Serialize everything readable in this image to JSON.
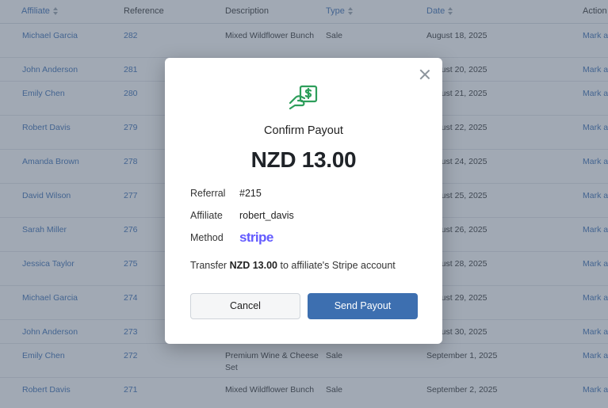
{
  "table": {
    "headers": [
      {
        "label": "Affiliate",
        "sortable": true
      },
      {
        "label": "Reference",
        "sortable": false
      },
      {
        "label": "Description",
        "sortable": false
      },
      {
        "label": "Type",
        "sortable": true
      },
      {
        "label": "Date",
        "sortable": true
      },
      {
        "label": "Action",
        "sortable": false
      }
    ],
    "rows": [
      {
        "affiliate": "Michael Garcia",
        "reference": "282",
        "description": "Mixed Wildflower Bunch",
        "type": "Sale",
        "date": "August 18, 2025",
        "action": "Mark as"
      },
      {
        "affiliate": "John Anderson",
        "reference": "281",
        "description": "",
        "type": "",
        "date": "August 20, 2025",
        "action": "Mark as"
      },
      {
        "affiliate": "Emily Chen",
        "reference": "280",
        "description": "",
        "type": "",
        "date": "August 21, 2025",
        "action": "Mark as"
      },
      {
        "affiliate": "Robert Davis",
        "reference": "279",
        "description": "",
        "type": "",
        "date": "August 22, 2025",
        "action": "Mark as"
      },
      {
        "affiliate": "Amanda Brown",
        "reference": "278",
        "description": "",
        "type": "",
        "date": "August 24, 2025",
        "action": "Mark as"
      },
      {
        "affiliate": "David Wilson",
        "reference": "277",
        "description": "",
        "type": "",
        "date": "August 25, 2025",
        "action": "Mark as"
      },
      {
        "affiliate": "Sarah Miller",
        "reference": "276",
        "description": "",
        "type": "",
        "date": "August 26, 2025",
        "action": "Mark as"
      },
      {
        "affiliate": "Jessica Taylor",
        "reference": "275",
        "description": "",
        "type": "",
        "date": "August 28, 2025",
        "action": "Mark as"
      },
      {
        "affiliate": "Michael Garcia",
        "reference": "274",
        "description": "",
        "type": "",
        "date": "August 29, 2025",
        "action": "Mark as"
      },
      {
        "affiliate": "John Anderson",
        "reference": "273",
        "description": "",
        "type": "",
        "date": "August 30, 2025",
        "action": "Mark as"
      },
      {
        "affiliate": "Emily Chen",
        "reference": "272",
        "description": "Premium Wine & Cheese Set",
        "type": "Sale",
        "date": "September 1, 2025",
        "action": "Mark as"
      },
      {
        "affiliate": "Robert Davis",
        "reference": "271",
        "description": "Mixed Wildflower Bunch",
        "type": "Sale",
        "date": "September 2, 2025",
        "action": "Mark as"
      }
    ]
  },
  "modal": {
    "title": "Confirm Payout",
    "amount": "NZD 13.00",
    "referral_label": "Referral",
    "referral_value": "#215",
    "affiliate_label": "Affiliate",
    "affiliate_value": "robert_davis",
    "method_label": "Method",
    "method_value": "stripe",
    "note_prefix": "Transfer ",
    "note_amount": "NZD 13.00",
    "note_suffix": " to affiliate's Stripe account",
    "cancel_label": "Cancel",
    "send_label": "Send Payout",
    "icons": {
      "payout": "hand-money-icon",
      "close": "close-icon"
    }
  },
  "colors": {
    "accent": "#3d6fb0",
    "link": "#3c6fb4",
    "icon_green": "#2e9e5b",
    "stripe_purple": "#635bff",
    "overlay": "#4a5a70"
  }
}
